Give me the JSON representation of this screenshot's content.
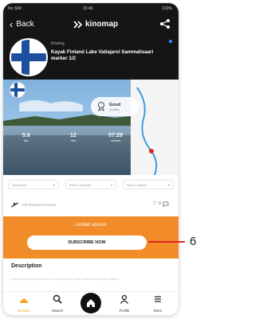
{
  "status_bar": {
    "carrier": "No SIM",
    "time": "15:45",
    "battery": "100%"
  },
  "nav": {
    "back_label": "Back",
    "brand": "kinomap"
  },
  "route": {
    "category": "Rowing",
    "title": "Kayak Finland Lake Vatiajarvi Sammalisaari marker 1/2"
  },
  "quality_badge": {
    "label": "Good",
    "sub": "Quality"
  },
  "stats": [
    {
      "value": "5.8",
      "unit": "km"
    },
    {
      "value": "12",
      "unit": "min"
    },
    {
      "value": "07:29",
      "unit": "min/km"
    }
  ],
  "selects": [
    {
      "label": "Download"
    },
    {
      "label": "Add to favorites"
    },
    {
      "label": "Add to playlist"
    }
  ],
  "sessions": {
    "label": "103 finished sessions"
  },
  "likes": {
    "count": "0"
  },
  "access": {
    "title": "Limited access",
    "button": "SUBSCRIBE NOW"
  },
  "description": {
    "title": "Description",
    "text": "Kayaking in Kinomap's new & uninterrupted route where a stationary marker..."
  },
  "tabs": [
    {
      "label": "Browse",
      "icon": "browse-icon",
      "active": true
    },
    {
      "label": "Search",
      "icon": "search-icon"
    },
    {
      "label": "",
      "icon": "home-icon"
    },
    {
      "label": "Profile",
      "icon": "profile-icon"
    },
    {
      "label": "More",
      "icon": "menu-icon"
    }
  ],
  "callout": {
    "number": "6"
  },
  "colors": {
    "accent": "#f28c28",
    "header": "#151515",
    "callout": "#e0261f",
    "active_tab": "#f2a81e"
  }
}
